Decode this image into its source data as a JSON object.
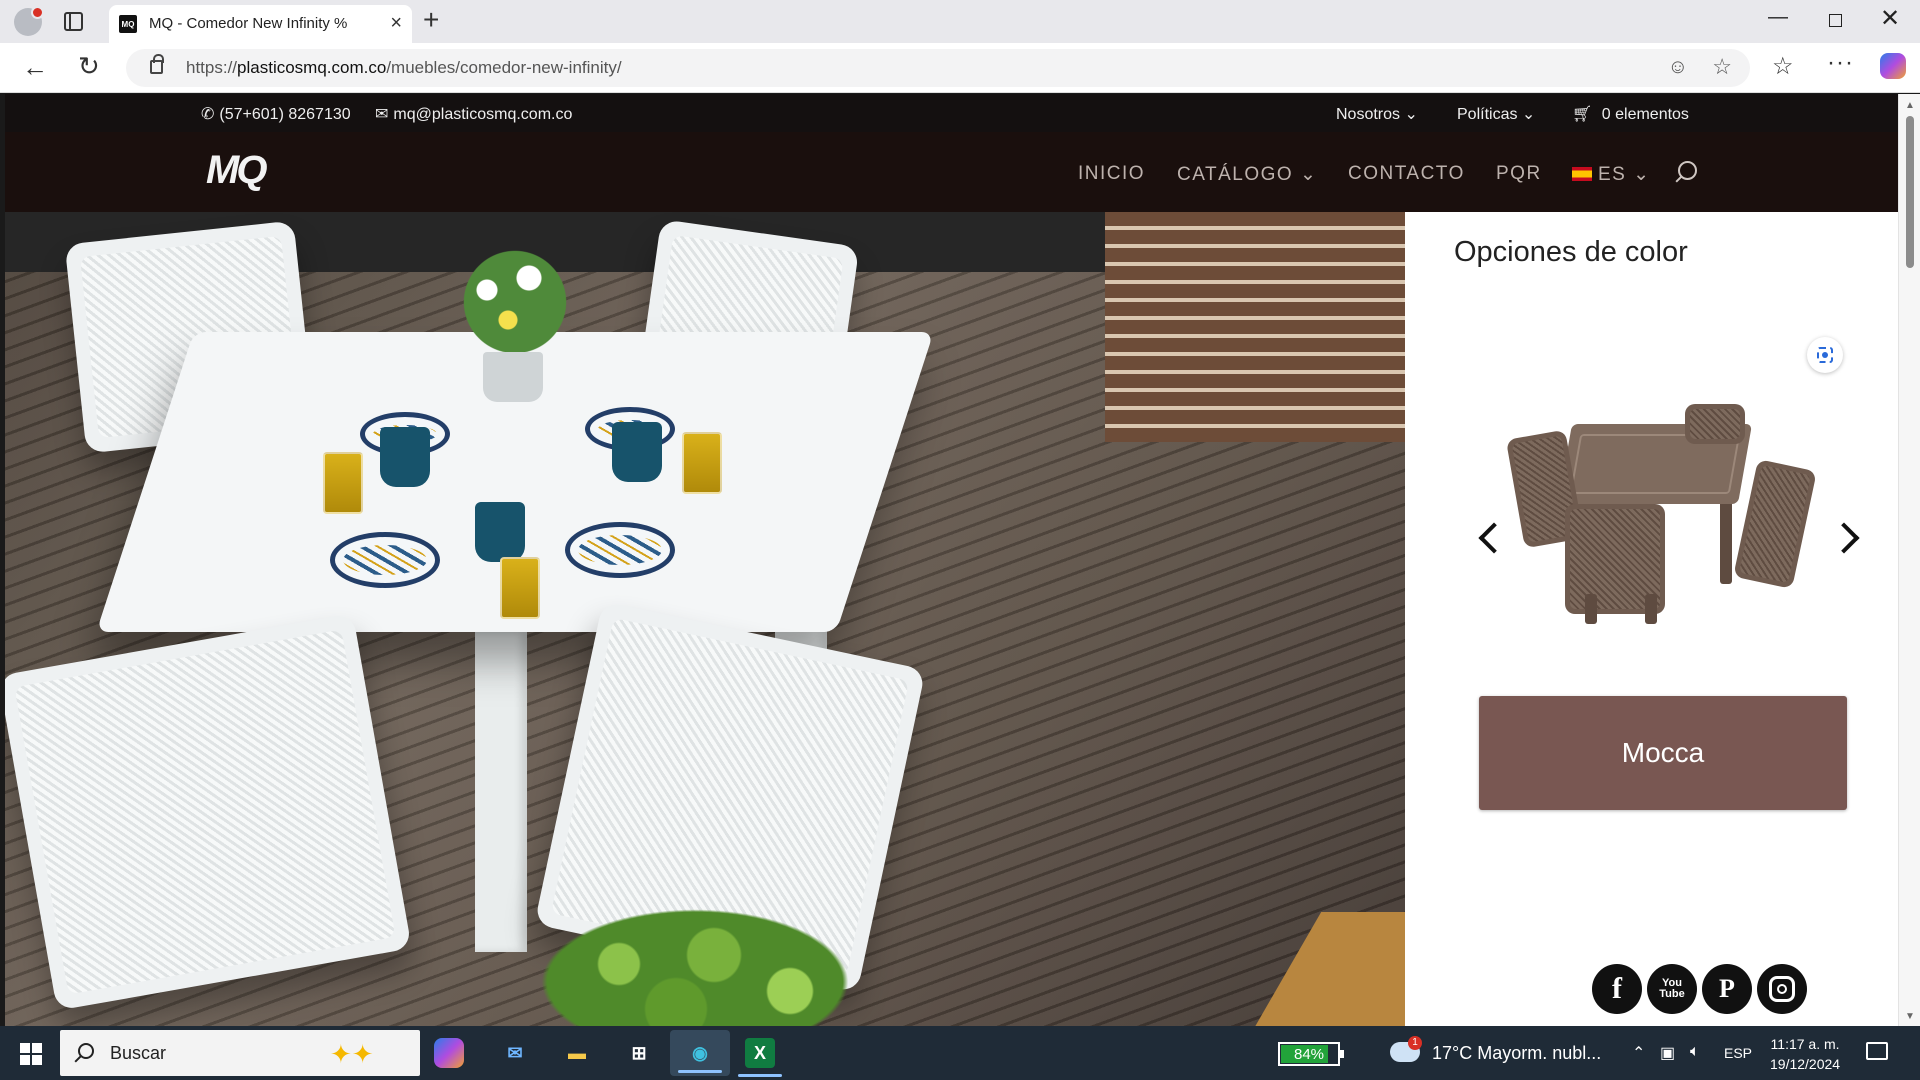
{
  "browser": {
    "tab_title": "MQ - Comedor New Infinity %",
    "tab_favicon": "MQ",
    "url_prefix": "https://",
    "url_domain": "plasticosmq.com.co",
    "url_path": "/muebles/comedor-new-infinity/"
  },
  "topbar": {
    "phone": "(57+601) 8267130",
    "email": "mq@plasticosmq.com.co",
    "menu_nosotros": "Nosotros",
    "menu_politicas": "Políticas",
    "cart": "0 elementos"
  },
  "nav": {
    "logo": "MQ",
    "items": [
      "INICIO",
      "CATÁLOGO",
      "CONTACTO",
      "PQR",
      "ES"
    ]
  },
  "panel": {
    "title": "Opciones de color",
    "color_button": "Mocca"
  },
  "social": {
    "facebook": "f",
    "youtube_line1": "You",
    "youtube_line2": "Tube",
    "pinterest": "P"
  },
  "taskbar": {
    "search_placeholder": "Buscar",
    "battery": "84%",
    "battery_level": 0.84,
    "weather": "17°C  Mayorm. nubl...",
    "weather_badge": "1",
    "lang": "ESP",
    "time": "11:17 a. m.",
    "date": "19/12/2024",
    "apps": [
      "copilot-app",
      "outlook-app",
      "file-explorer-app",
      "store-app",
      "edge-app",
      "excel-app"
    ]
  },
  "colors": {
    "mocca": "#795752",
    "topbar_bg": "#141010",
    "nav_bg": "#1a0f0d"
  }
}
